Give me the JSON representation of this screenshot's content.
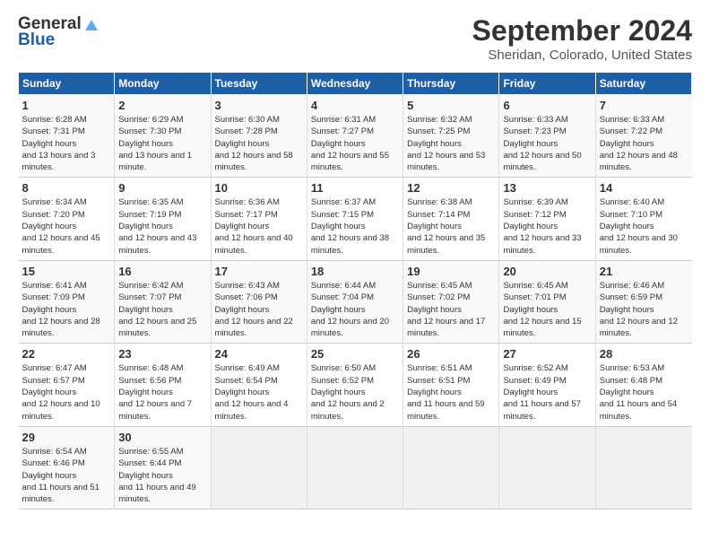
{
  "logo": {
    "general": "General",
    "blue": "Blue"
  },
  "title": "September 2024",
  "subtitle": "Sheridan, Colorado, United States",
  "days_of_week": [
    "Sunday",
    "Monday",
    "Tuesday",
    "Wednesday",
    "Thursday",
    "Friday",
    "Saturday"
  ],
  "weeks": [
    [
      {
        "day": "1",
        "sunrise": "6:28 AM",
        "sunset": "7:31 PM",
        "daylight": "13 hours and 3 minutes."
      },
      {
        "day": "2",
        "sunrise": "6:29 AM",
        "sunset": "7:30 PM",
        "daylight": "13 hours and 1 minute."
      },
      {
        "day": "3",
        "sunrise": "6:30 AM",
        "sunset": "7:28 PM",
        "daylight": "12 hours and 58 minutes."
      },
      {
        "day": "4",
        "sunrise": "6:31 AM",
        "sunset": "7:27 PM",
        "daylight": "12 hours and 55 minutes."
      },
      {
        "day": "5",
        "sunrise": "6:32 AM",
        "sunset": "7:25 PM",
        "daylight": "12 hours and 53 minutes."
      },
      {
        "day": "6",
        "sunrise": "6:33 AM",
        "sunset": "7:23 PM",
        "daylight": "12 hours and 50 minutes."
      },
      {
        "day": "7",
        "sunrise": "6:33 AM",
        "sunset": "7:22 PM",
        "daylight": "12 hours and 48 minutes."
      }
    ],
    [
      {
        "day": "8",
        "sunrise": "6:34 AM",
        "sunset": "7:20 PM",
        "daylight": "12 hours and 45 minutes."
      },
      {
        "day": "9",
        "sunrise": "6:35 AM",
        "sunset": "7:19 PM",
        "daylight": "12 hours and 43 minutes."
      },
      {
        "day": "10",
        "sunrise": "6:36 AM",
        "sunset": "7:17 PM",
        "daylight": "12 hours and 40 minutes."
      },
      {
        "day": "11",
        "sunrise": "6:37 AM",
        "sunset": "7:15 PM",
        "daylight": "12 hours and 38 minutes."
      },
      {
        "day": "12",
        "sunrise": "6:38 AM",
        "sunset": "7:14 PM",
        "daylight": "12 hours and 35 minutes."
      },
      {
        "day": "13",
        "sunrise": "6:39 AM",
        "sunset": "7:12 PM",
        "daylight": "12 hours and 33 minutes."
      },
      {
        "day": "14",
        "sunrise": "6:40 AM",
        "sunset": "7:10 PM",
        "daylight": "12 hours and 30 minutes."
      }
    ],
    [
      {
        "day": "15",
        "sunrise": "6:41 AM",
        "sunset": "7:09 PM",
        "daylight": "12 hours and 28 minutes."
      },
      {
        "day": "16",
        "sunrise": "6:42 AM",
        "sunset": "7:07 PM",
        "daylight": "12 hours and 25 minutes."
      },
      {
        "day": "17",
        "sunrise": "6:43 AM",
        "sunset": "7:06 PM",
        "daylight": "12 hours and 22 minutes."
      },
      {
        "day": "18",
        "sunrise": "6:44 AM",
        "sunset": "7:04 PM",
        "daylight": "12 hours and 20 minutes."
      },
      {
        "day": "19",
        "sunrise": "6:45 AM",
        "sunset": "7:02 PM",
        "daylight": "12 hours and 17 minutes."
      },
      {
        "day": "20",
        "sunrise": "6:45 AM",
        "sunset": "7:01 PM",
        "daylight": "12 hours and 15 minutes."
      },
      {
        "day": "21",
        "sunrise": "6:46 AM",
        "sunset": "6:59 PM",
        "daylight": "12 hours and 12 minutes."
      }
    ],
    [
      {
        "day": "22",
        "sunrise": "6:47 AM",
        "sunset": "6:57 PM",
        "daylight": "12 hours and 10 minutes."
      },
      {
        "day": "23",
        "sunrise": "6:48 AM",
        "sunset": "6:56 PM",
        "daylight": "12 hours and 7 minutes."
      },
      {
        "day": "24",
        "sunrise": "6:49 AM",
        "sunset": "6:54 PM",
        "daylight": "12 hours and 4 minutes."
      },
      {
        "day": "25",
        "sunrise": "6:50 AM",
        "sunset": "6:52 PM",
        "daylight": "12 hours and 2 minutes."
      },
      {
        "day": "26",
        "sunrise": "6:51 AM",
        "sunset": "6:51 PM",
        "daylight": "11 hours and 59 minutes."
      },
      {
        "day": "27",
        "sunrise": "6:52 AM",
        "sunset": "6:49 PM",
        "daylight": "11 hours and 57 minutes."
      },
      {
        "day": "28",
        "sunrise": "6:53 AM",
        "sunset": "6:48 PM",
        "daylight": "11 hours and 54 minutes."
      }
    ],
    [
      {
        "day": "29",
        "sunrise": "6:54 AM",
        "sunset": "6:46 PM",
        "daylight": "11 hours and 51 minutes."
      },
      {
        "day": "30",
        "sunrise": "6:55 AM",
        "sunset": "6:44 PM",
        "daylight": "11 hours and 49 minutes."
      },
      null,
      null,
      null,
      null,
      null
    ]
  ]
}
